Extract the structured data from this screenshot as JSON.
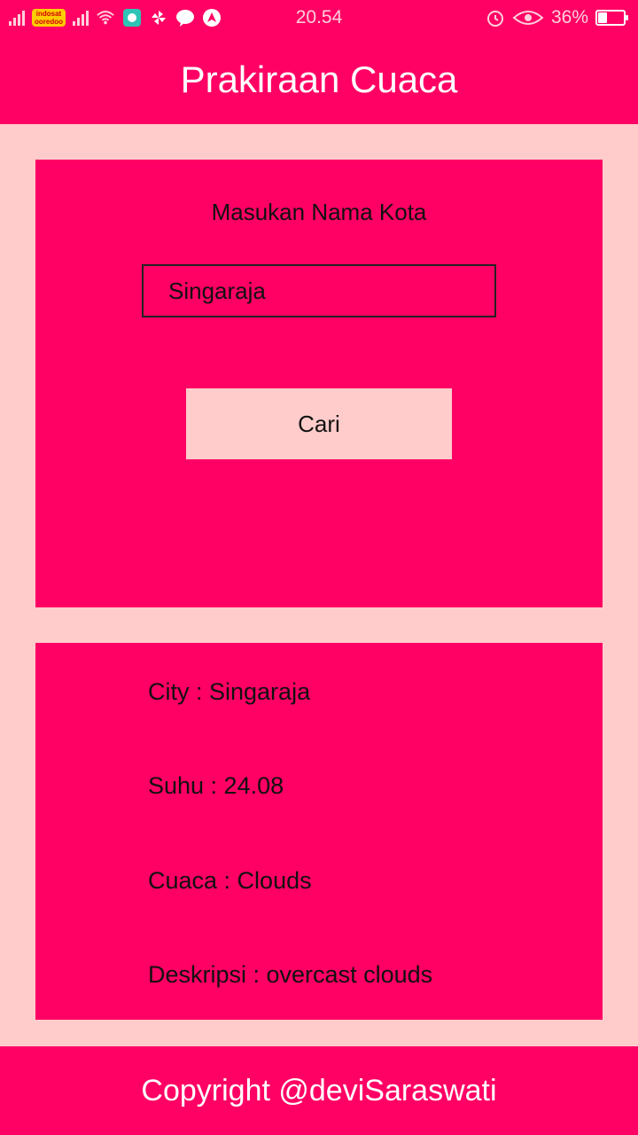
{
  "status_bar": {
    "carrier": "indosat ooredoo",
    "time": "20.54",
    "battery_text": "36%",
    "battery_level": 0.36,
    "icons": [
      "signal-icon",
      "wifi-icon",
      "app-notification-icon",
      "pinwheel-icon",
      "line-icon",
      "nav-icon",
      "alarm-icon",
      "eye-icon",
      "battery-icon"
    ]
  },
  "app_bar": {
    "title": "Prakiraan Cuaca"
  },
  "search": {
    "label": "Masukan Nama Kota",
    "input_value": "Singaraja",
    "button_label": "Cari"
  },
  "result": {
    "city": "City : Singaraja",
    "temperature": "Suhu : 24.08",
    "weather": "Cuaca : Clouds",
    "description": "Deskripsi : overcast clouds"
  },
  "footer": {
    "text": "Copyright @deviSaraswati"
  },
  "colors": {
    "primary": "#ff0064",
    "background": "#ffcccb"
  }
}
